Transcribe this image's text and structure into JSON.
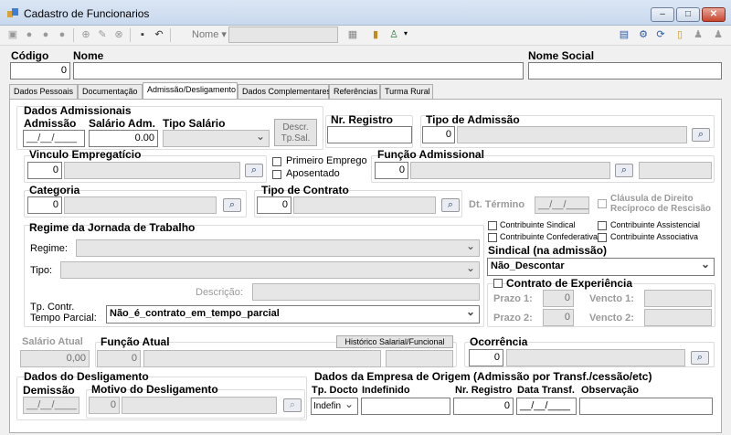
{
  "window": {
    "title": "Cadastro de Funcionarios",
    "minimize": "–",
    "maximize": "□",
    "close": "✕"
  },
  "toolbar": {
    "nome_label": "Nome",
    "nome_value": ""
  },
  "header": {
    "codigo_label": "Código",
    "codigo_value": "0",
    "nome_label": "Nome",
    "nome_value": "",
    "nome_social_label": "Nome Social",
    "nome_social_value": ""
  },
  "tabs": [
    "Dados Pessoais",
    "Documentação",
    "Admissão/Desligamento",
    "Dados Complementares",
    "Referências",
    "Turma Rural"
  ],
  "admissionais": {
    "group_title": "Dados Admissionais",
    "admissao_label": "Admissão",
    "admissao_value": "__/__/____",
    "salario_label": "Salário Adm.",
    "salario_value": "0.00",
    "tipo_salario_label": "Tipo Salário",
    "tipo_salario_value": "",
    "descr_btn": "Descr. Tp.Sal.",
    "nr_registro_label": "Nr. Registro",
    "nr_registro_value": "",
    "tipo_admissao_label": "Tipo de Admissão",
    "tipo_admissao_code": "0",
    "tipo_admissao_desc": ""
  },
  "vinculo": {
    "label": "Vinculo Empregatício",
    "code": "0",
    "desc": "",
    "primeiro_emprego": "Primeiro Emprego",
    "aposentado": "Aposentado"
  },
  "funcao_adm": {
    "label": "Função Admissional",
    "code": "0",
    "desc": "",
    "extra": ""
  },
  "categoria": {
    "label": "Categoria",
    "code": "0",
    "desc": ""
  },
  "tipo_contrato": {
    "label": "Tipo de Contrato",
    "code": "0",
    "desc": "",
    "dt_termino_label": "Dt. Término",
    "dt_termino_value": "__/__/____",
    "clausula": "Cláusula de Direito Recíproco de Rescisão"
  },
  "regime": {
    "title": "Regime da Jornada de Trabalho",
    "regime_label": "Regime:",
    "regime_value": "",
    "tipo_label": "Tipo:",
    "tipo_value": "",
    "descricao_label": "Descrição:",
    "descricao_value": "",
    "tp_contr_label": "Tp. Contr. Tempo Parcial:",
    "tp_contr_value": "Não_é_contrato_em_tempo_parcial"
  },
  "sindical": {
    "contrib_sindical": "Contribuinte Sindical",
    "contrib_assistencial": "Contribuinte Assistencial",
    "contrib_confederativa": "Contribuinte Confederativa",
    "contrib_associativa": "Contribuinte Associativa",
    "label": "Sindical (na admissão)",
    "value": "Não_Descontar"
  },
  "experiencia": {
    "label": "Contrato de Experiência",
    "prazo1_label": "Prazo 1:",
    "prazo1": "0",
    "vencto1_label": "Vencto 1:",
    "vencto1": "",
    "prazo2_label": "Prazo 2:",
    "prazo2": "0",
    "vencto2_label": "Vencto 2:",
    "vencto2": ""
  },
  "atual": {
    "salario_label": "Salário Atual",
    "salario_value": "0,00",
    "funcao_label": "Função Atual",
    "funcao_code": "0",
    "funcao_desc": "",
    "historico_btn": "Histórico Salarial/Funcional",
    "ocorrencia_label": "Ocorrência",
    "ocorrencia_code": "0",
    "ocorrencia_desc": ""
  },
  "desligamento": {
    "title": "Dados do Desligamento",
    "demissao_label": "Demissão",
    "demissao_value": "__/__/____",
    "motivo_label": "Motivo do Desligamento",
    "motivo_code": "0",
    "motivo_desc": ""
  },
  "origem": {
    "title": "Dados da Empresa de Origem (Admissão por Transf./cessão/etc)",
    "tp_docto_label": "Tp. Docto",
    "tp_docto_value": "Indefin",
    "indefinido_label": "Indefinido",
    "indefinido_value": "",
    "nr_registro_label": "Nr. Registro",
    "nr_registro_value": "0",
    "data_transf_label": "Data Transf.",
    "data_transf_value": "__/__/____",
    "observacao_label": "Observação",
    "observacao_value": ""
  }
}
